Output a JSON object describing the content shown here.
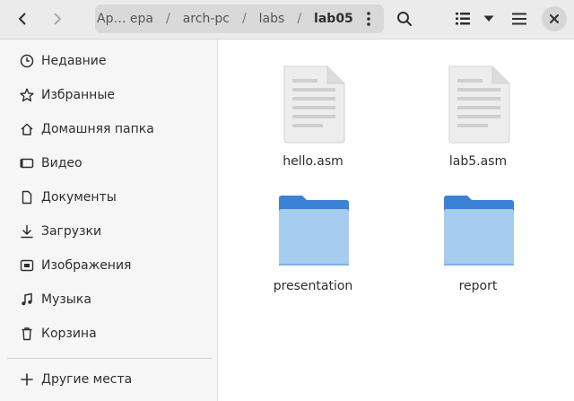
{
  "header": {
    "path": [
      "Ар… ера",
      "arch-pc",
      "labs",
      "lab05"
    ],
    "separator": "/"
  },
  "sidebar": {
    "items": [
      {
        "label": "Недавние",
        "icon": "clock-icon"
      },
      {
        "label": "Избранные",
        "icon": "star-icon"
      },
      {
        "label": "Домашняя папка",
        "icon": "home-icon"
      },
      {
        "label": "Видео",
        "icon": "video-icon"
      },
      {
        "label": "Документы",
        "icon": "document-icon"
      },
      {
        "label": "Загрузки",
        "icon": "download-icon"
      },
      {
        "label": "Изображения",
        "icon": "image-icon"
      },
      {
        "label": "Музыка",
        "icon": "music-icon"
      },
      {
        "label": "Корзина",
        "icon": "trash-icon"
      }
    ],
    "other_locations": {
      "label": "Другие места",
      "icon": "plus-icon"
    }
  },
  "files": [
    {
      "name": "hello.asm",
      "type": "text-file"
    },
    {
      "name": "lab5.asm",
      "type": "text-file"
    },
    {
      "name": "presentation",
      "type": "folder"
    },
    {
      "name": "report",
      "type": "folder"
    }
  ],
  "colors": {
    "folder_top": "#3b82d6",
    "folder_body": "#a6cdf0",
    "header_bg": "#ebebeb",
    "sidebar_bg": "#f6f6f6",
    "pathbar_bg": "#d9d9d9"
  }
}
